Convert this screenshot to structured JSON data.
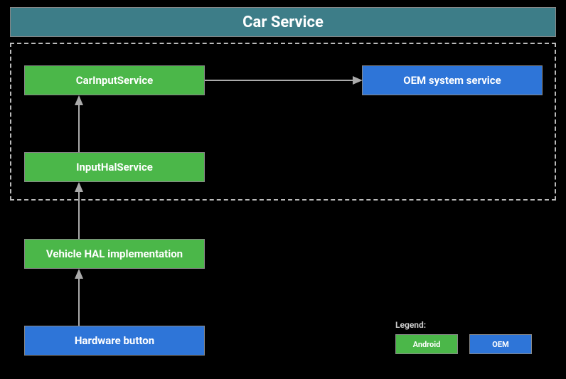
{
  "header": {
    "title": "Car Service"
  },
  "boxes": {
    "carInputService": "CarInputService",
    "oemSystemService": "OEM system service",
    "inputHalService": "InputHalService",
    "vehicleHal": "Vehicle HAL implementation",
    "hardwareButton": "Hardware button"
  },
  "legend": {
    "title": "Legend:",
    "android": "Android",
    "oem": "OEM"
  }
}
